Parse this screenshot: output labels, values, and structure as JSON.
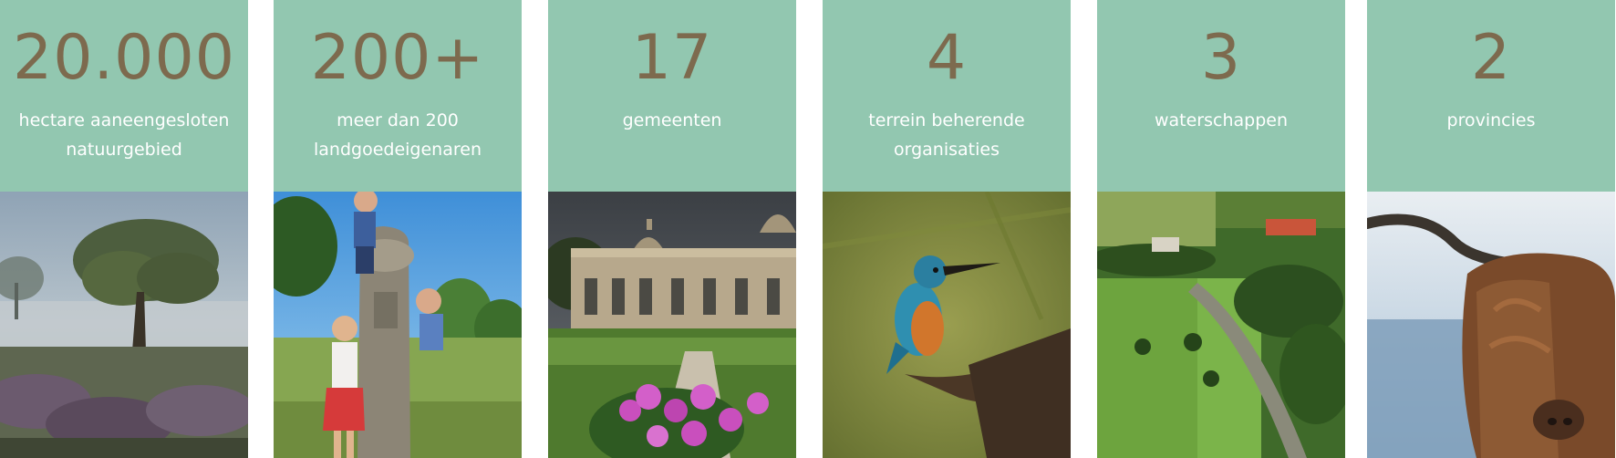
{
  "cards": [
    {
      "number": "20.000",
      "line1": "hectare aaneengesloten",
      "line2": "natuurgebied",
      "photo": "misty-heathland-tree"
    },
    {
      "number": "200+",
      "line1": "meer dan 200",
      "line2": "landgoedeigenaren",
      "photo": "children-climbing-statue"
    },
    {
      "number": "17",
      "line1": "gemeenten",
      "line2": "",
      "photo": "historic-orangery-building"
    },
    {
      "number": "4",
      "line1": "terrein beherende",
      "line2": "organisaties",
      "photo": "kingfisher-on-branch"
    },
    {
      "number": "3",
      "line1": "waterschappen",
      "line2": "",
      "photo": "aerial-estate-landscape"
    },
    {
      "number": "2",
      "line1": "provincies",
      "line2": "",
      "photo": "highland-cow"
    }
  ],
  "colors": {
    "header_bg": "#92c7b0",
    "number_color": "#7d6a4e",
    "caption_color": "#ffffff"
  }
}
